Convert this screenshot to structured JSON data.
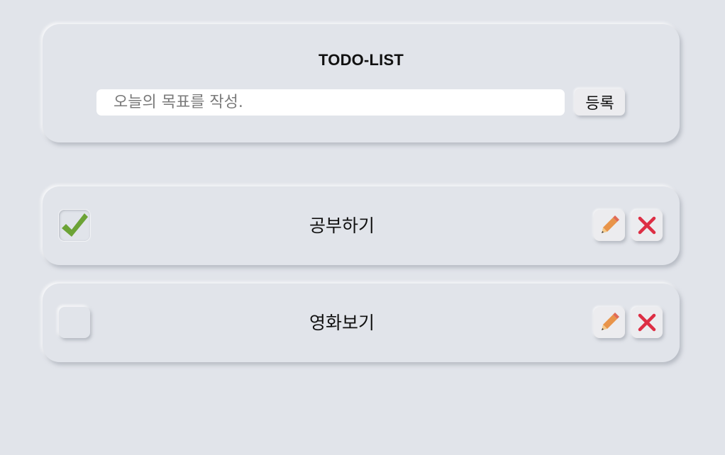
{
  "header": {
    "title": "TODO-LIST",
    "input": {
      "placeholder": "오늘의 목표를 작성.",
      "value": ""
    },
    "submit_label": "등록"
  },
  "todos": [
    {
      "text": "공부하기",
      "done": true
    },
    {
      "text": "영화보기",
      "done": false
    }
  ],
  "icons": {
    "check": "checkmark-icon",
    "edit": "pencil-icon",
    "delete": "close-icon"
  },
  "colors": {
    "background": "#e1e4ea",
    "check_green": "#6ca336",
    "pencil_orange": "#e8944a",
    "delete_red": "#dd2e44"
  }
}
